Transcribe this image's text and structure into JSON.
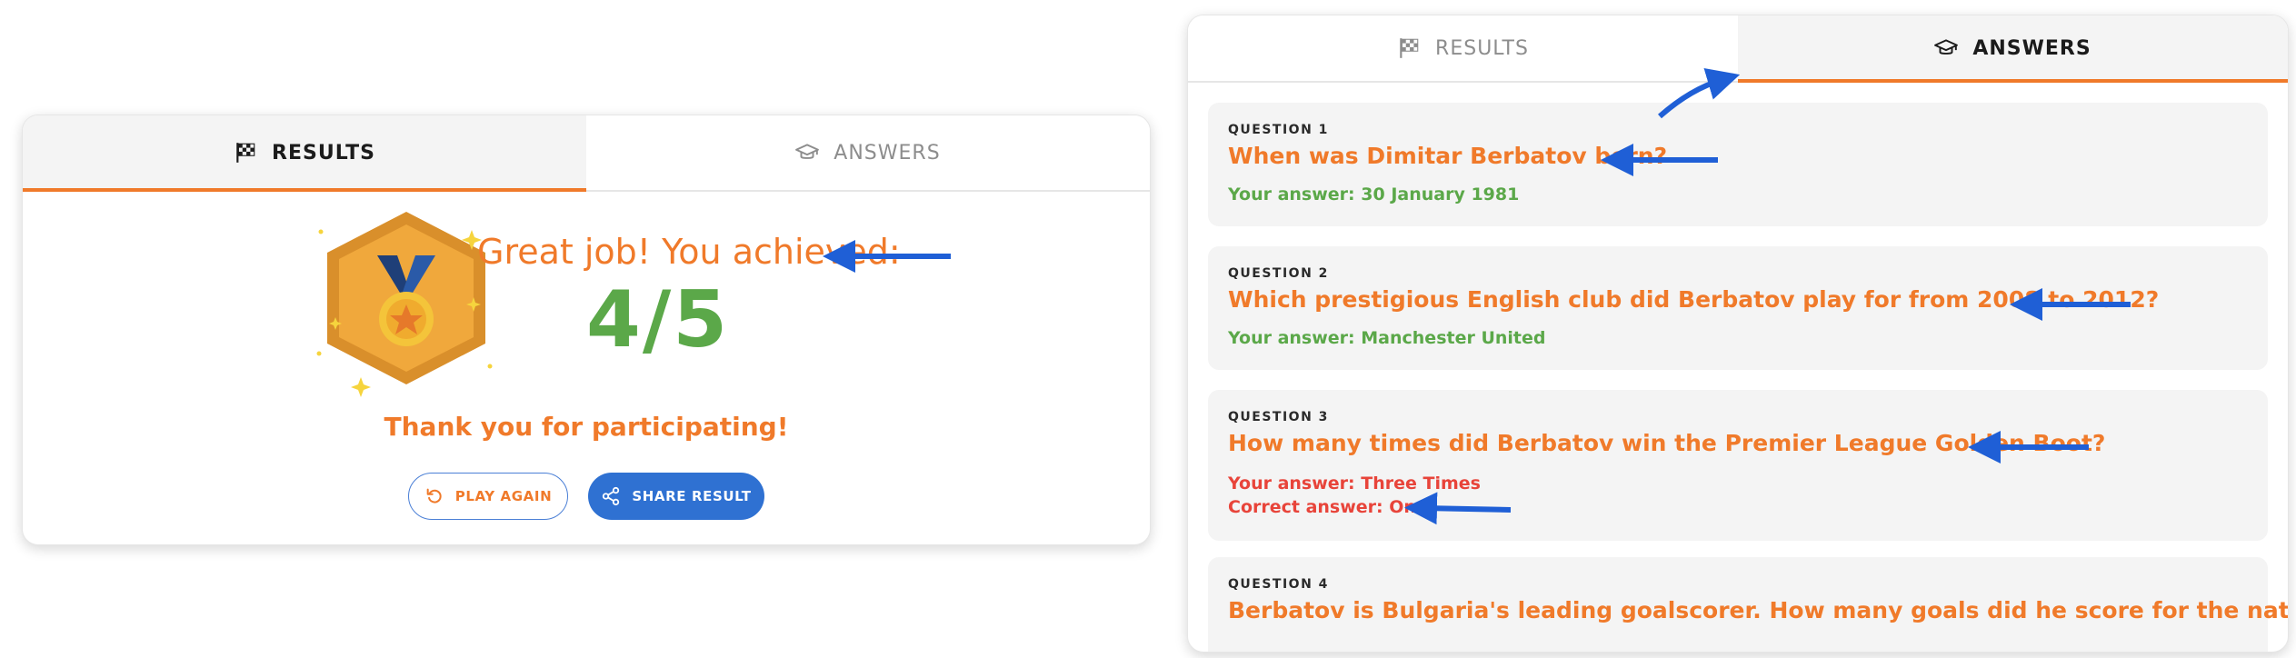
{
  "tabs": {
    "results_label": "RESULTS",
    "answers_label": "ANSWERS"
  },
  "result": {
    "headline": "Great job! You achieved:",
    "score": "4/5",
    "thanks": "Thank you for participating!",
    "play_again_label": "PLAY AGAIN",
    "share_label": "SHARE RESULT"
  },
  "questions": [
    {
      "number": "QUESTION 1",
      "text": "When was Dimitar Berbatov born?",
      "your_answer": "Your answer: 30 January 1981",
      "correct": true
    },
    {
      "number": "QUESTION 2",
      "text": "Which prestigious English club did Berbatov play for from 2008 to 2012?",
      "your_answer": "Your answer: Manchester United",
      "correct": true
    },
    {
      "number": "QUESTION 3",
      "text": "How many times did Berbatov win the Premier League Golden Boot?",
      "your_answer": "Your answer: Three Times",
      "correct_answer": "Correct answer: Once",
      "correct": false
    },
    {
      "number": "QUESTION 4",
      "text": "Berbatov is Bulgaria's leading goalscorer. How many goals did he score for the national team?"
    }
  ],
  "colors": {
    "accent_orange": "#f07a2a",
    "correct_green": "#5ba849",
    "wrong_red": "#e8443a",
    "primary_blue": "#2f71d2",
    "annotation_arrow": "#1f5fd6"
  },
  "icons": {
    "results_tab": "checkered-flag-icon",
    "answers_tab": "graduation-cap-icon",
    "play_again": "refresh-icon",
    "share": "share-icon",
    "medal": "medal-badge-icon"
  }
}
